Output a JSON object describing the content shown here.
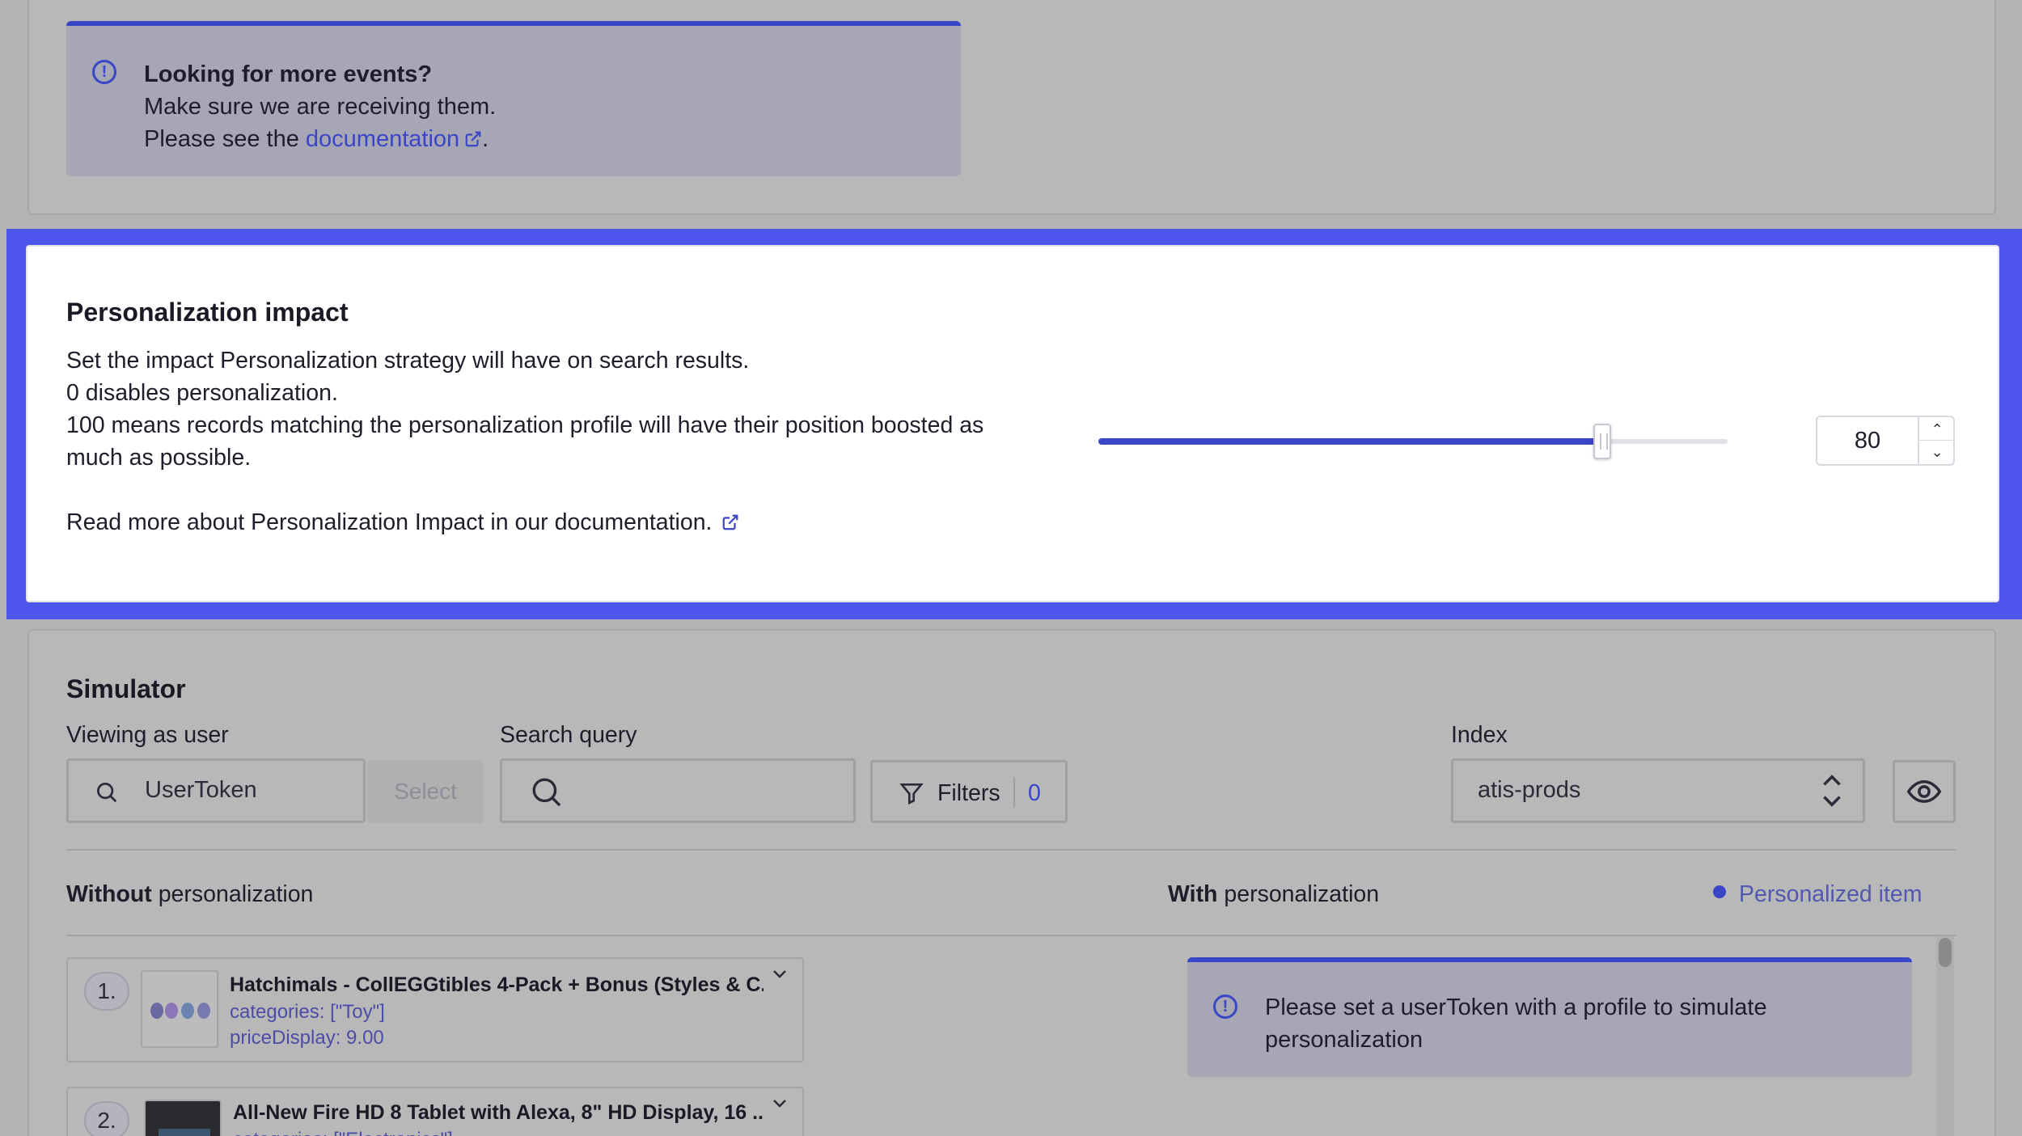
{
  "notice": {
    "title": "Looking for more events?",
    "line1": "Make sure we are receiving them.",
    "line2_prefix": "Please see the",
    "link": "documentation",
    "line2_suffix": "."
  },
  "impact": {
    "title": "Personalization impact",
    "desc1": "Set the impact Personalization strategy will have on search results.",
    "desc2": "0 disables personalization.",
    "desc3": "100 means records matching the personalization profile will have their position boosted as",
    "desc4": "much as possible.",
    "link": "Read more about Personalization Impact in our documentation.",
    "value": "80",
    "slider_percent": 80
  },
  "simulator": {
    "title": "Simulator",
    "viewing_label": "Viewing as user",
    "user_placeholder": "UserToken",
    "select_label": "Select",
    "query_label": "Search query",
    "query_value": "",
    "filters_label": "Filters",
    "filters_count": "0",
    "index_label": "Index",
    "index_value": "atis-prods",
    "without_bold": "Without",
    "without_rest": "personalization",
    "with_bold": "With",
    "with_rest": "personalization",
    "legend": "Personalized item",
    "info": {
      "line1": "Please set a userToken with a profile to simulate",
      "line2": "personalization"
    },
    "results": [
      {
        "rank": "1.",
        "title": "Hatchimals - CollEGGtibles 4-Pack + Bonus (Styles & C...",
        "categories": "categories: [\"Toy\"]",
        "price": "priceDisplay: 9.00"
      },
      {
        "rank": "2.",
        "title": "All-New Fire HD 8 Tablet with Alexa, 8\" HD Display, 16 ...",
        "categories": "categories: [\"Electronics\"]",
        "price": ""
      }
    ]
  },
  "colors": {
    "accent": "#3a45c8",
    "highlight": "#4d55ec",
    "overlay": "#b3b3b3"
  }
}
